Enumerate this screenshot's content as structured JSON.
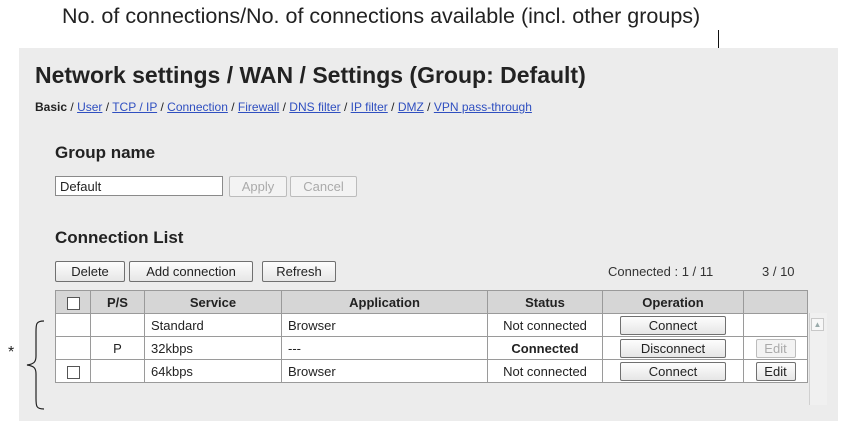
{
  "annotation": {
    "top_label": "No. of connections/No. of connections available (incl. other groups)",
    "asterisk": "*"
  },
  "page": {
    "title": "Network settings / WAN / Settings (Group: Default)",
    "breadcrumb": {
      "current": "Basic",
      "separator": "/",
      "links": [
        "User",
        "TCP / IP",
        "Connection",
        "Firewall",
        "DNS filter",
        "IP filter",
        "DMZ",
        "VPN pass-through"
      ]
    }
  },
  "group_name": {
    "heading": "Group name",
    "value": "Default",
    "apply_label": "Apply",
    "cancel_label": "Cancel"
  },
  "connection_list": {
    "heading": "Connection List",
    "delete_label": "Delete",
    "add_label": "Add connection",
    "refresh_label": "Refresh",
    "connected_text": "Connected : 1 / 11",
    "count_text": "3 / 10",
    "columns": [
      "",
      "P/S",
      "Service",
      "Application",
      "Status",
      "Operation",
      ""
    ],
    "rows": [
      {
        "checkbox": false,
        "ps": "",
        "service": "Standard",
        "application": "Browser",
        "status": "Not connected",
        "operation": "Connect",
        "edit": ""
      },
      {
        "checkbox": false,
        "ps": "P",
        "service": "32kbps",
        "application": "---",
        "status": "Connected",
        "operation": "Disconnect",
        "edit": "Edit"
      },
      {
        "checkbox": true,
        "ps": "",
        "service": "64kbps",
        "application": "Browser",
        "status": "Not connected",
        "operation": "Connect",
        "edit": "Edit"
      }
    ]
  },
  "colors": {
    "connected_status": "#2e9a3a",
    "link": "#2f4fc0",
    "panel_background": "#ececec"
  }
}
